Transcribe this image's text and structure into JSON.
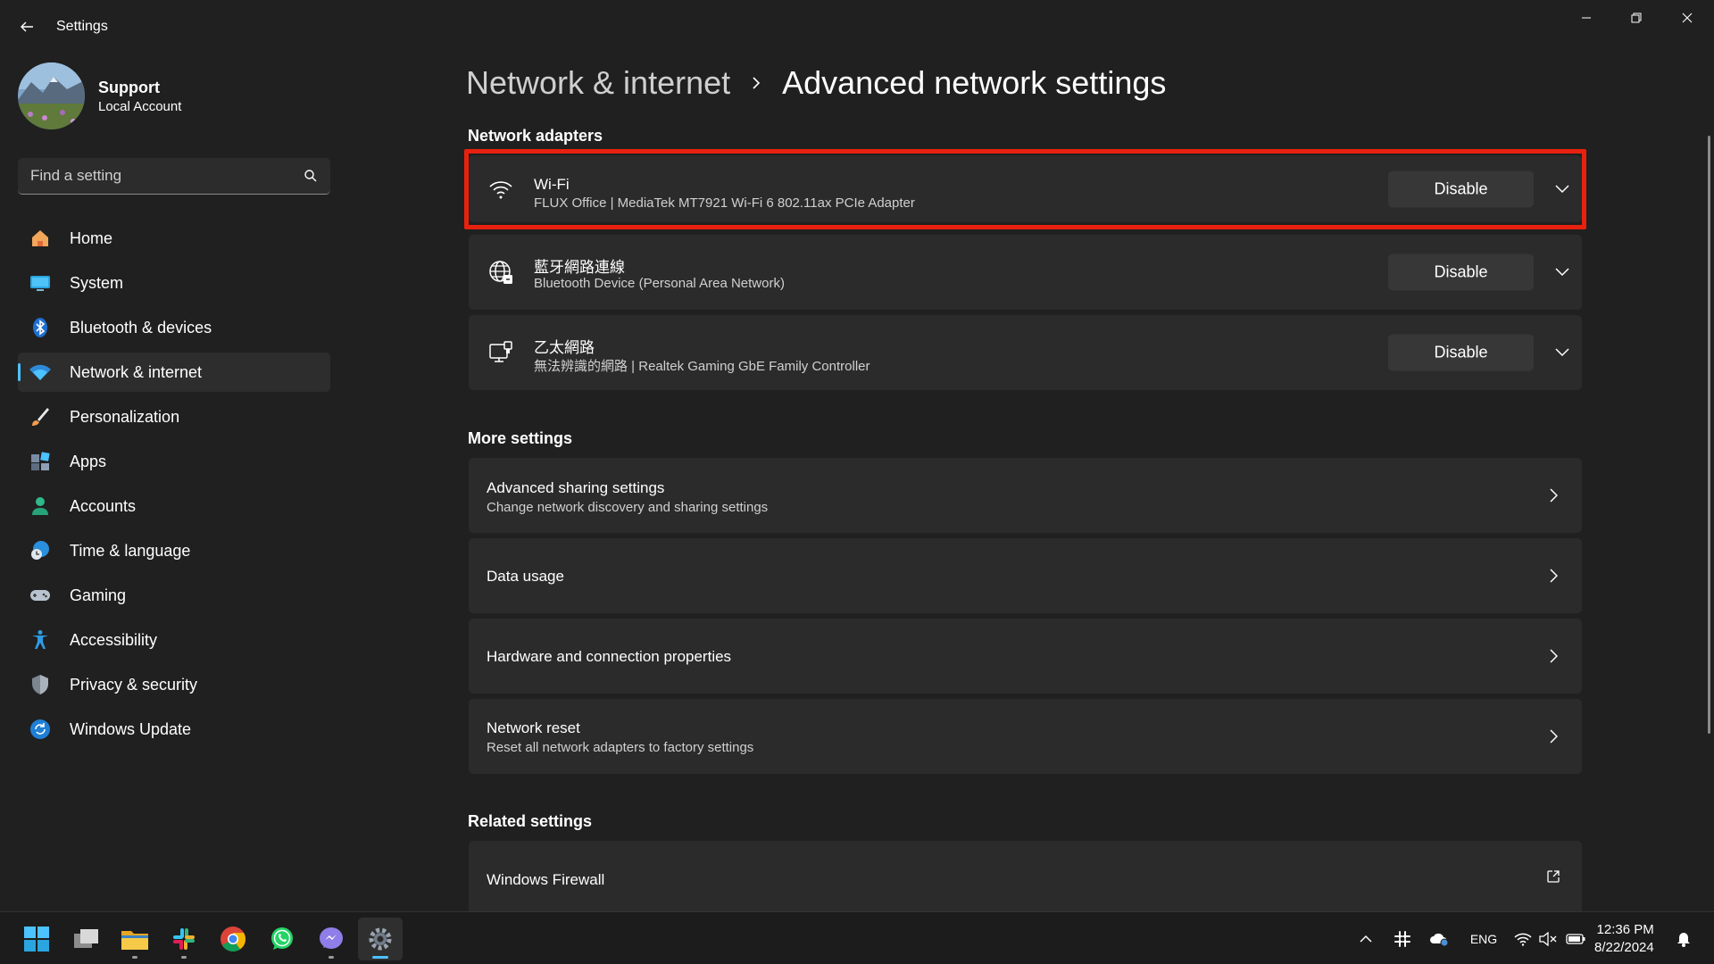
{
  "window": {
    "title": "Settings"
  },
  "profile": {
    "name": "Support",
    "account_type": "Local Account"
  },
  "search": {
    "placeholder": "Find a setting"
  },
  "sidebar": {
    "items": [
      {
        "label": "Home",
        "icon": "home-icon",
        "active": false
      },
      {
        "label": "System",
        "icon": "system-icon",
        "active": false
      },
      {
        "label": "Bluetooth & devices",
        "icon": "bluetooth-icon",
        "active": false
      },
      {
        "label": "Network & internet",
        "icon": "wifi-icon",
        "active": true
      },
      {
        "label": "Personalization",
        "icon": "brush-icon",
        "active": false
      },
      {
        "label": "Apps",
        "icon": "apps-icon",
        "active": false
      },
      {
        "label": "Accounts",
        "icon": "person-icon",
        "active": false
      },
      {
        "label": "Time & language",
        "icon": "globe-clock-icon",
        "active": false
      },
      {
        "label": "Gaming",
        "icon": "gamepad-icon",
        "active": false
      },
      {
        "label": "Accessibility",
        "icon": "accessibility-icon",
        "active": false
      },
      {
        "label": "Privacy & security",
        "icon": "shield-icon",
        "active": false
      },
      {
        "label": "Windows Update",
        "icon": "update-icon",
        "active": false
      }
    ]
  },
  "breadcrumb": {
    "parent": "Network & internet",
    "current": "Advanced network settings"
  },
  "network_adapters": {
    "title": "Network adapters",
    "items": [
      {
        "name": "Wi-Fi",
        "description": "FLUX Office | MediaTek MT7921 Wi-Fi 6 802.11ax PCIe Adapter",
        "button": "Disable",
        "icon": "wifi-signal-icon"
      },
      {
        "name": "藍牙網路連線",
        "description": "Bluetooth Device (Personal Area Network)",
        "button": "Disable",
        "icon": "globe-network-icon"
      },
      {
        "name": "乙太網路",
        "description": "無法辨識的網路 | Realtek Gaming GbE Family Controller",
        "button": "Disable",
        "icon": "ethernet-icon"
      }
    ]
  },
  "more_settings": {
    "title": "More settings",
    "items": [
      {
        "title": "Advanced sharing settings",
        "subtitle": "Change network discovery and sharing settings"
      },
      {
        "title": "Data usage",
        "subtitle": ""
      },
      {
        "title": "Hardware and connection properties",
        "subtitle": ""
      },
      {
        "title": "Network reset",
        "subtitle": "Reset all network adapters to factory settings"
      }
    ]
  },
  "related_settings": {
    "title": "Related settings",
    "items": [
      {
        "title": "Windows Firewall",
        "icon": "external-link-icon"
      }
    ]
  },
  "taskbar": {
    "language": "ENG",
    "time": "12:36 PM",
    "date": "8/22/2024"
  },
  "colors": {
    "accent": "#4cc2ff",
    "highlight": "#e8210f",
    "background": "#202020",
    "card": "#2b2b2b"
  }
}
